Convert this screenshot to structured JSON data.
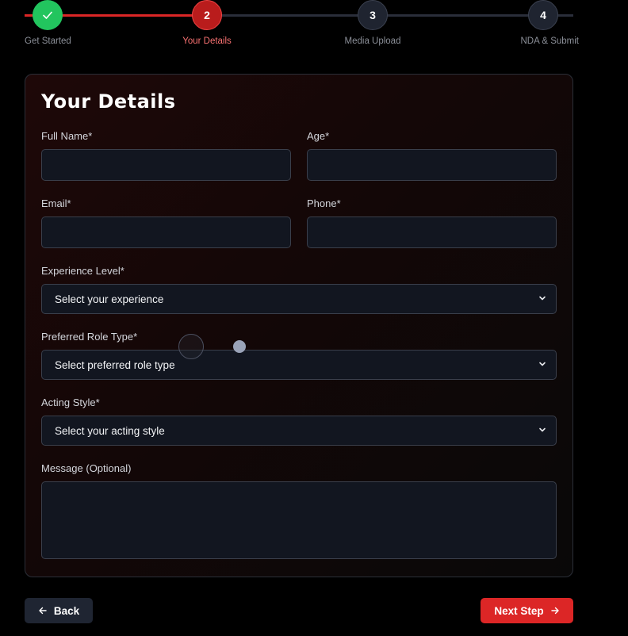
{
  "stepper": {
    "steps": [
      {
        "number": "",
        "label": "Get Started",
        "state": "complete"
      },
      {
        "number": "2",
        "label": "Your Details",
        "state": "active"
      },
      {
        "number": "3",
        "label": "Media Upload",
        "state": "pending"
      },
      {
        "number": "4",
        "label": "NDA & Submit",
        "state": "pending"
      }
    ]
  },
  "form": {
    "title": "Your Details",
    "full_name": {
      "label": "Full Name*",
      "value": ""
    },
    "age": {
      "label": "Age*",
      "value": ""
    },
    "email": {
      "label": "Email*",
      "value": ""
    },
    "phone": {
      "label": "Phone*",
      "value": ""
    },
    "experience": {
      "label": "Experience Level*",
      "selected": "Select your experience"
    },
    "role_type": {
      "label": "Preferred Role Type*",
      "selected": "Select preferred role type"
    },
    "acting_style": {
      "label": "Acting Style*",
      "selected": "Select your acting style"
    },
    "message": {
      "label": "Message (Optional)",
      "value": ""
    }
  },
  "actions": {
    "back_label": "Back",
    "next_label": "Next Step"
  },
  "colors": {
    "accent": "#dc2626",
    "success": "#22c55e",
    "field_bg": "#121620"
  }
}
